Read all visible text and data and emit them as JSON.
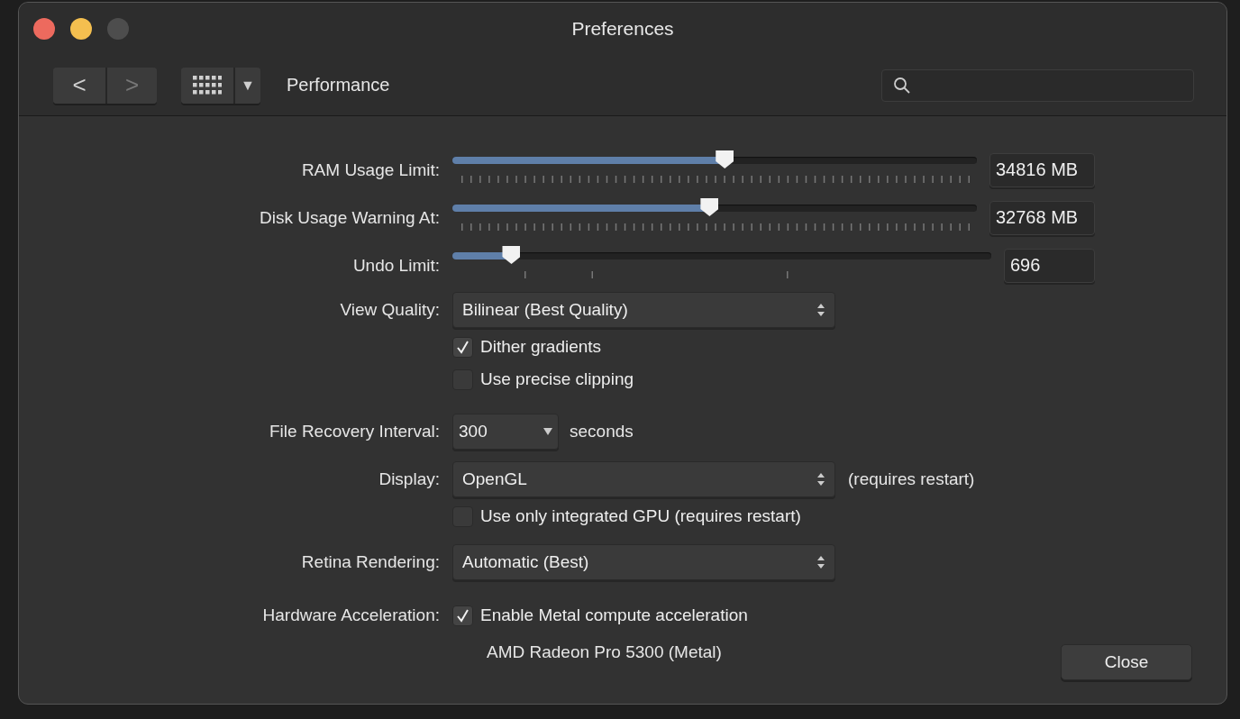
{
  "window": {
    "title": "Preferences"
  },
  "toolbar": {
    "back": "<",
    "forward": ">",
    "menu_caret": "▼",
    "section": "Performance"
  },
  "rows": [
    {
      "label": "RAM Usage Limit:",
      "control": {
        "kind": "slider",
        "level": 0.52,
        "value": "34816 MB"
      }
    },
    {
      "label": "Disk Usage Warning At:",
      "control": {
        "kind": "slider",
        "level": 0.49,
        "value": "32768 MB"
      }
    },
    {
      "label": "Undo Limit:",
      "control": {
        "kind": "stepslider",
        "level": 0.096,
        "value": "696"
      }
    },
    {
      "label": "View Quality:",
      "control": {
        "kind": "select",
        "value": "Bilinear (Best Quality)"
      }
    },
    {
      "control": {
        "kind": "checkbox",
        "label": "Dither gradients",
        "checked": true
      }
    },
    {
      "control": {
        "kind": "checkbox",
        "label": "Use precise clipping",
        "checked": false
      }
    },
    {
      "label": "File Recovery Interval:",
      "control": {
        "kind": "dropdown",
        "value": "300",
        "suffix": "seconds"
      }
    },
    {
      "label": "Display:",
      "control": {
        "kind": "select",
        "value": "OpenGL",
        "note": "(requires restart)"
      }
    },
    {
      "control": {
        "kind": "checkbox",
        "label": "Use only integrated GPU (requires restart)",
        "checked": false
      }
    },
    {
      "label": "Retina Rendering:",
      "control": {
        "kind": "select",
        "value": "Automatic (Best)"
      }
    },
    {
      "label": "Hardware Acceleration:",
      "control": {
        "kind": "checkbox",
        "label": "Enable Metal compute acceleration",
        "checked": true
      }
    },
    {
      "control": {
        "kind": "info",
        "text": "AMD Radeon Pro 5300 (Metal)"
      }
    }
  ],
  "buttons": [
    "Close"
  ]
}
